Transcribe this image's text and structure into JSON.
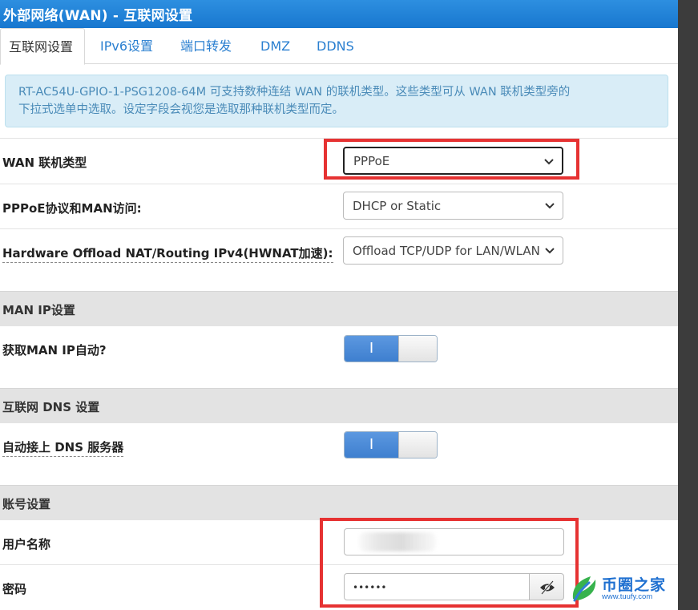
{
  "window": {
    "title": "外部网络(WAN) - 互联网设置"
  },
  "tabs": [
    {
      "label": "互联网设置",
      "active": true
    },
    {
      "label": "IPv6设置",
      "active": false
    },
    {
      "label": "端口转发",
      "active": false
    },
    {
      "label": "DMZ",
      "active": false
    },
    {
      "label": "DDNS",
      "active": false
    }
  ],
  "info": {
    "line1": "RT-AC54U-GPIO-1-PSG1208-64M 可支持数种连结 WAN 的联机类型。这些类型可从 WAN 联机类型旁的",
    "line2": "下拉式选单中选取。设定字段会视您是选取那种联机类型而定。"
  },
  "wan": {
    "type_label": "WAN 联机类型",
    "type_value": "PPPoE",
    "pppoe_label": "PPPoE协议和MAN访问:",
    "pppoe_value": "DHCP or Static",
    "hwnat_label": "Hardware Offload NAT/Routing IPv4(HWNAT加速):",
    "hwnat_value": "Offload TCP/UDP for LAN/WLAN"
  },
  "man_ip": {
    "section": "MAN IP设置",
    "auto_label": "获取MAN IP自动?",
    "auto_toggle": "I"
  },
  "dns": {
    "section": "互联网 DNS 设置",
    "auto_label": "自动接上 DNS 服务器",
    "auto_toggle": "I"
  },
  "account": {
    "section": "账号设置",
    "username_label": "用户名称",
    "username_value": "",
    "password_label": "密码",
    "password_value": "••••••"
  },
  "watermark": {
    "name": "币圈之家",
    "url": "www.tuufy.com"
  },
  "colors": {
    "title_bar": "#1877cf",
    "tab_link": "#2a7fd0",
    "info_bg": "#d9edf7",
    "toggle_on": "#3e7fcf",
    "highlight": "#e63232"
  },
  "icons": {
    "select_arrow": "chevron-down-icon",
    "password_reveal": "eye-slash-icon",
    "logo": "leaf-logo-icon"
  }
}
